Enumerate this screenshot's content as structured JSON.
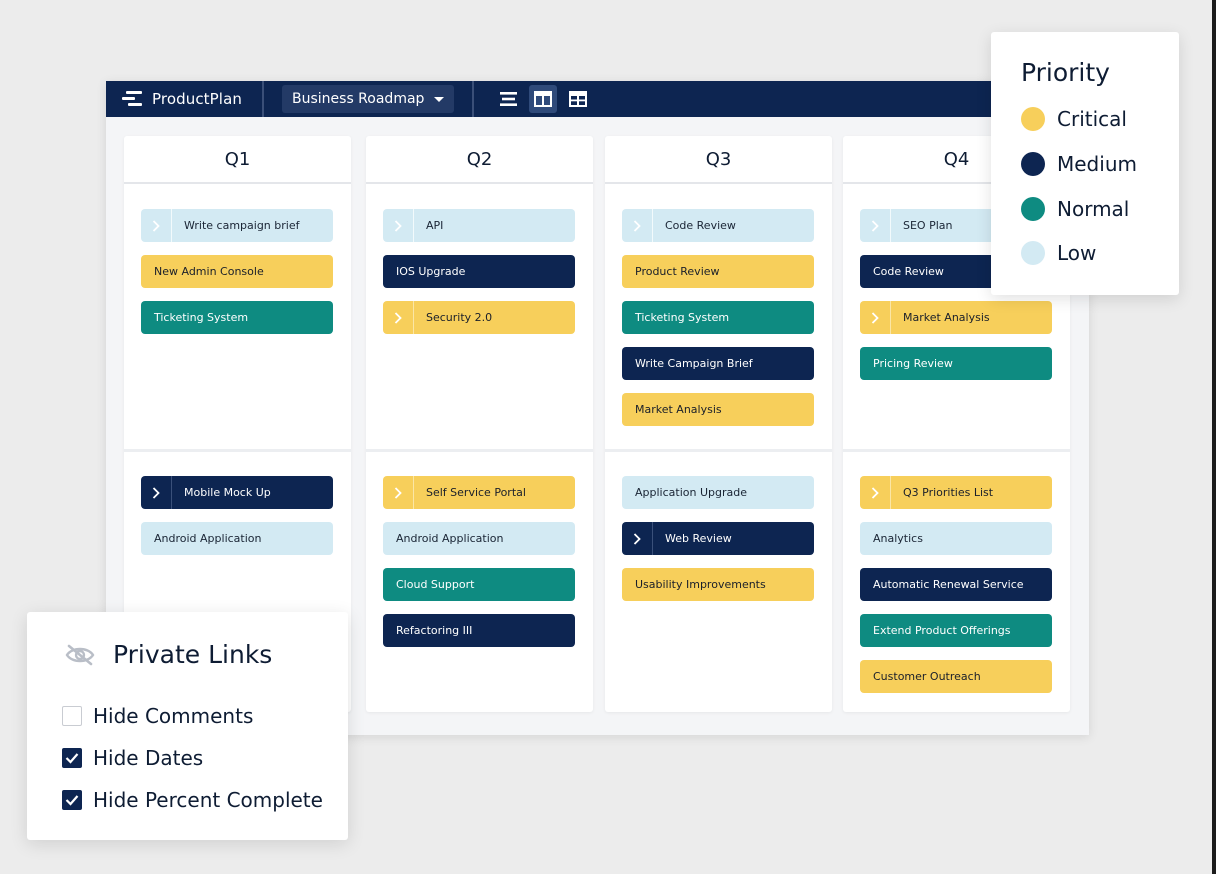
{
  "app": {
    "brand": "ProductPlan",
    "roadmap_select": "Business Roadmap",
    "views": [
      "list-view-icon",
      "board-view-icon",
      "table-view-icon"
    ],
    "active_view": "board-view-icon"
  },
  "columns": [
    {
      "title": "Q1",
      "top_cards": [
        {
          "label": "Write campaign brief",
          "priority": "low",
          "expandable": true
        },
        {
          "label": "New Admin Console",
          "priority": "critical",
          "expandable": false
        },
        {
          "label": "Ticketing System",
          "priority": "normal",
          "expandable": false
        }
      ],
      "bottom_cards": [
        {
          "label": "Mobile Mock Up",
          "priority": "medium",
          "expandable": true
        },
        {
          "label": "Android Application",
          "priority": "low",
          "expandable": false
        }
      ]
    },
    {
      "title": "Q2",
      "top_cards": [
        {
          "label": "API",
          "priority": "low",
          "expandable": true
        },
        {
          "label": "IOS Upgrade",
          "priority": "medium",
          "expandable": false
        },
        {
          "label": "Security 2.0",
          "priority": "critical",
          "expandable": true
        }
      ],
      "bottom_cards": [
        {
          "label": "Self Service Portal",
          "priority": "critical",
          "expandable": true
        },
        {
          "label": "Android Application",
          "priority": "low",
          "expandable": false
        },
        {
          "label": "Cloud Support",
          "priority": "normal",
          "expandable": false
        },
        {
          "label": "Refactoring III",
          "priority": "medium",
          "expandable": false
        }
      ]
    },
    {
      "title": "Q3",
      "top_cards": [
        {
          "label": "Code Review",
          "priority": "low",
          "expandable": true
        },
        {
          "label": "Product Review",
          "priority": "critical",
          "expandable": false
        },
        {
          "label": "Ticketing System",
          "priority": "normal",
          "expandable": false
        },
        {
          "label": "Write Campaign Brief",
          "priority": "medium",
          "expandable": false
        },
        {
          "label": "Market Analysis",
          "priority": "critical",
          "expandable": false
        }
      ],
      "bottom_cards": [
        {
          "label": "Application Upgrade",
          "priority": "low",
          "expandable": false
        },
        {
          "label": "Web Review",
          "priority": "medium",
          "expandable": true
        },
        {
          "label": "Usability Improvements",
          "priority": "critical",
          "expandable": false
        }
      ]
    },
    {
      "title": "Q4",
      "top_cards": [
        {
          "label": "SEO Plan",
          "priority": "low",
          "expandable": true
        },
        {
          "label": "Code Review",
          "priority": "medium",
          "expandable": false
        },
        {
          "label": "Market Analysis",
          "priority": "critical",
          "expandable": true
        },
        {
          "label": "Pricing Review",
          "priority": "normal",
          "expandable": false
        }
      ],
      "bottom_cards": [
        {
          "label": "Q3 Priorities List",
          "priority": "critical",
          "expandable": true
        },
        {
          "label": "Analytics",
          "priority": "low",
          "expandable": false
        },
        {
          "label": "Automatic Renewal Service",
          "priority": "medium",
          "expandable": false
        },
        {
          "label": "Extend Product Offerings",
          "priority": "normal",
          "expandable": false
        },
        {
          "label": "Customer Outreach",
          "priority": "critical",
          "expandable": false
        }
      ]
    }
  ],
  "legend": {
    "title": "Priority",
    "items": [
      {
        "key": "critical",
        "label": "Critical",
        "color": "#f7cf5b"
      },
      {
        "key": "medium",
        "label": "Medium",
        "color": "#0d2551"
      },
      {
        "key": "normal",
        "label": "Normal",
        "color": "#0e8b81"
      },
      {
        "key": "low",
        "label": "Low",
        "color": "#d3eaf3"
      }
    ]
  },
  "private_links": {
    "title": "Private Links",
    "icon": "eye-slash-icon",
    "options": [
      {
        "label": "Hide Comments",
        "checked": false
      },
      {
        "label": "Hide Dates",
        "checked": true
      },
      {
        "label": "Hide Percent Complete",
        "checked": true
      }
    ]
  }
}
